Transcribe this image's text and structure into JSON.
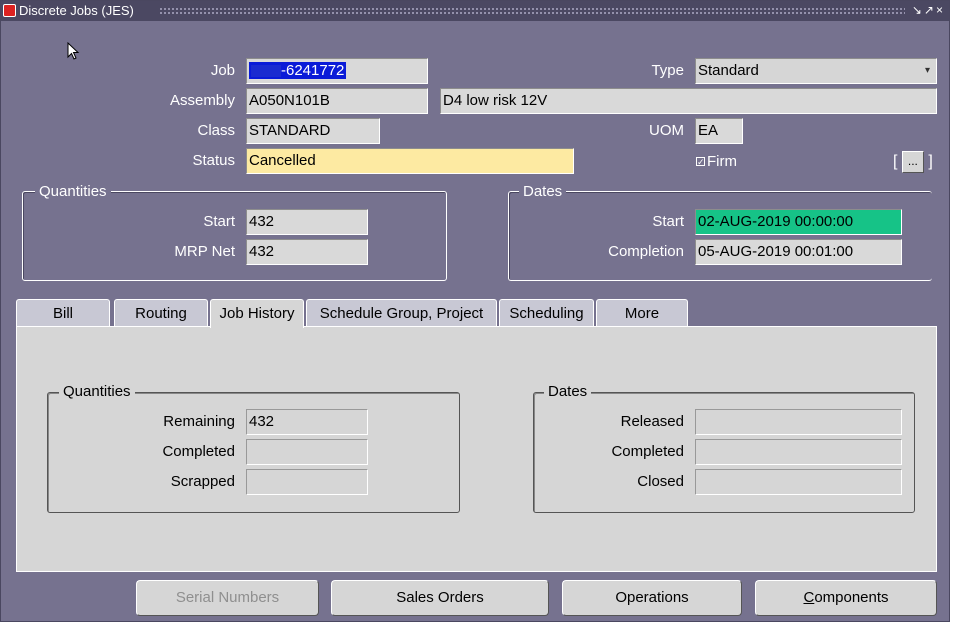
{
  "window": {
    "title": "Discrete Jobs (JES)",
    "controls": "↘↗×"
  },
  "header": {
    "job_label": "Job",
    "job_value": "-6241772",
    "type_label": "Type",
    "type_value": "Standard",
    "assembly_label": "Assembly",
    "assembly_value": "A050N101B",
    "assembly_desc": "D4 low risk 12V",
    "class_label": "Class",
    "class_value": "STANDARD",
    "uom_label": "UOM",
    "uom_value": "EA",
    "status_label": "Status",
    "status_value": "Cancelled",
    "firm_label": "Firm",
    "firm_checked": true,
    "flex_button": "..."
  },
  "quantities": {
    "title": "Quantities",
    "start_label": "Start",
    "start_value": "432",
    "mrp_label": "MRP Net",
    "mrp_value": "432"
  },
  "dates": {
    "title": "Dates",
    "start_label": "Start",
    "start_value": "02-AUG-2019 00:00:00",
    "completion_label": "Completion",
    "completion_value": "05-AUG-2019 00:01:00"
  },
  "tabs": [
    {
      "label": "Bill"
    },
    {
      "label": "Routing"
    },
    {
      "label": "Job History"
    },
    {
      "label": "Schedule Group, Project"
    },
    {
      "label": "Scheduling"
    },
    {
      "label": "More"
    }
  ],
  "history": {
    "quantities_title": "Quantities",
    "remaining_label": "Remaining",
    "remaining_value": "432",
    "completed_label": "Completed",
    "completed_value": "",
    "scrapped_label": "Scrapped",
    "scrapped_value": "",
    "dates_title": "Dates",
    "released_label": "Released",
    "released_value": "",
    "dcompleted_label": "Completed",
    "dcompleted_value": "",
    "closed_label": "Closed",
    "closed_value": ""
  },
  "buttons": {
    "serial": "Serial Numbers",
    "sales": "Sales Orders",
    "operations": "Operations",
    "components_first": "C",
    "components_rest": "omponents"
  },
  "colors": {
    "window_bg": "#76728f",
    "title_bg": "#4b4862",
    "status_bg": "#fdeaa2",
    "date_highlight": "#16c387",
    "selection": "#0a1bd8"
  }
}
